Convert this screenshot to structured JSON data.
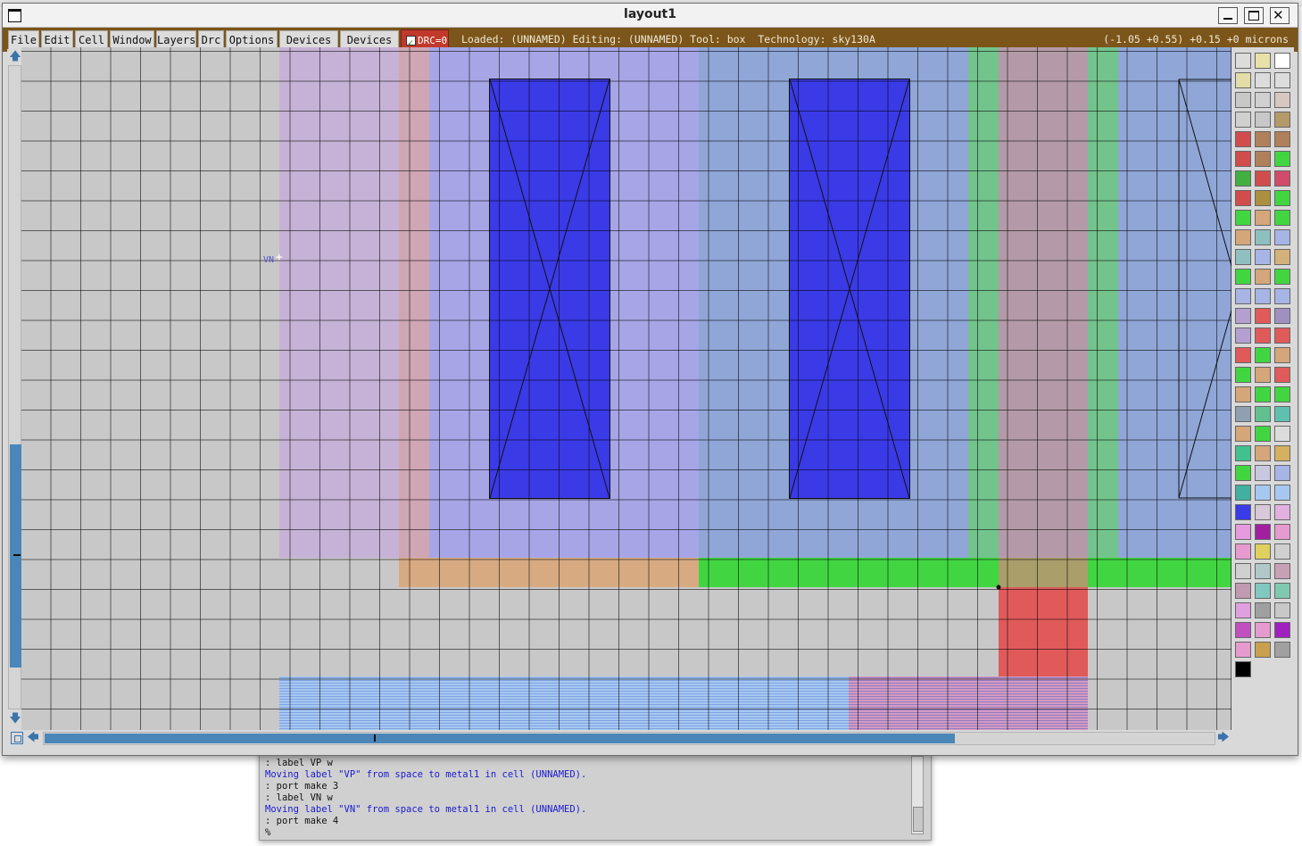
{
  "window": {
    "title": "layout1",
    "controls": {
      "minimize": "minimize",
      "maximize": "maximize",
      "close": "close"
    }
  },
  "menubar": {
    "items": [
      "File",
      "Edit",
      "Cell",
      "Window",
      "Layers",
      "Drc",
      "Options",
      "Devices 1",
      "Devices 2"
    ],
    "drc_label": "DRC=0",
    "drc_checked": true,
    "status": "Loaded: (UNNAMED) Editing: (UNNAMED) Tool: box  Technology: sky130A",
    "coordinates": "(-1.05 +0.55) +0.15 +0 microns",
    "bar_color": "#7b5519",
    "drc_color": "#c0392b"
  },
  "canvas": {
    "label_text": "VN",
    "layer_colors": {
      "background": "#c8c8c8",
      "pwell_purple": "#c6b2d6",
      "pink": "#cfa6b3",
      "ndiff_blue": "#a6a6e6",
      "steel_blue": "#8fa6d6",
      "metal_green": "#73c38c",
      "poly_mauve": "#b49aa8",
      "contact_blue": "#3a3ae6",
      "tan": "#d8aa82",
      "bright_green": "#41d641",
      "olive": "#aa9e6a",
      "red": "#e05a5a",
      "metal2_lightblue": "#a6c8f0",
      "metal2_pink": "#d49ac0"
    }
  },
  "console": {
    "lines": [
      {
        "text": ": label VP w",
        "color": "black"
      },
      {
        "text": "Moving label \"VP\" from space to metal1 in cell (UNNAMED).",
        "color": "blue"
      },
      {
        "text": ": port make 3",
        "color": "black"
      },
      {
        "text": ": label VN w",
        "color": "black"
      },
      {
        "text": "Moving label \"VN\" from space to metal1 in cell (UNNAMED).",
        "color": "blue"
      },
      {
        "text": ": port make 4",
        "color": "black"
      },
      {
        "text": "%",
        "color": "black"
      }
    ]
  },
  "scrollbars": {
    "vertical_thumb_fraction": 0.33,
    "horizontal_thumb_fraction": 0.78
  }
}
